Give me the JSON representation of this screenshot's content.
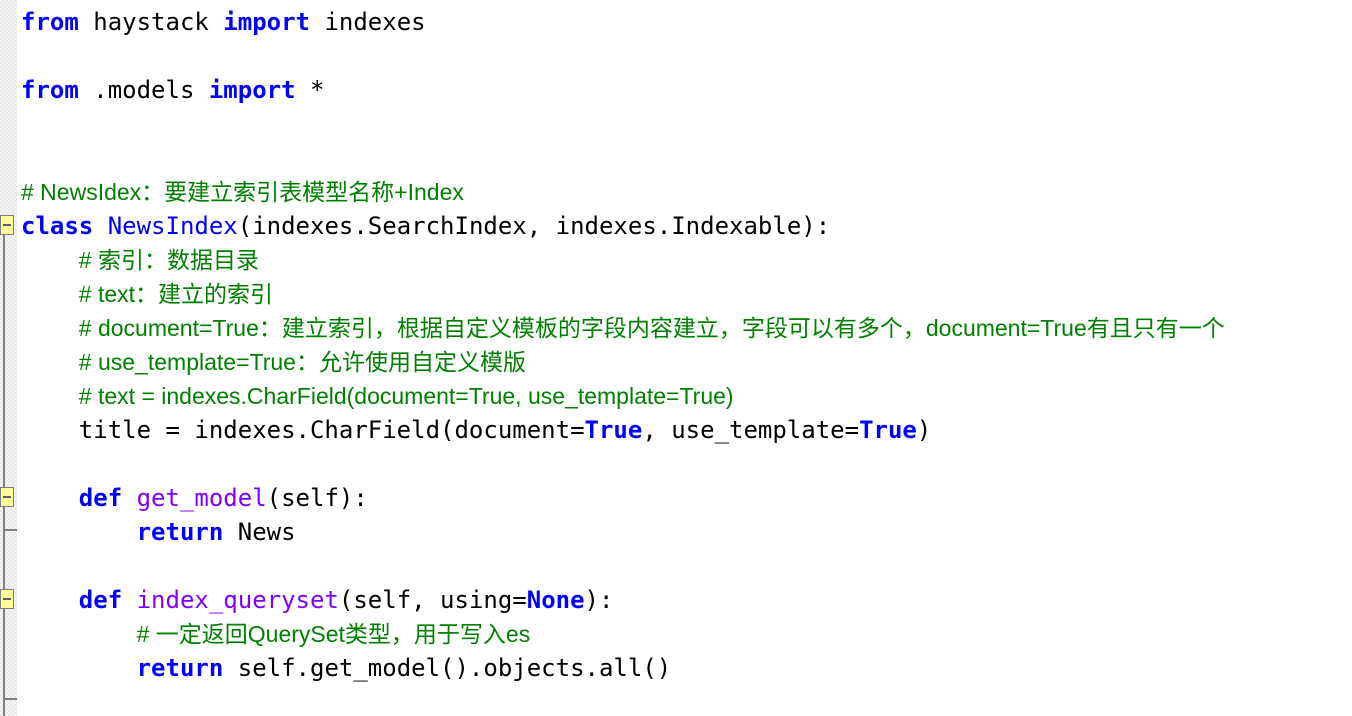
{
  "colors": {
    "keyword": "#0000ff",
    "function": "#8000ff",
    "comment": "#008000",
    "text": "#000000",
    "fold_marker": "#ffff99"
  },
  "editor": {
    "lines": [
      [
        {
          "t": "# ...",
          "c": "cm"
        }
      ],
      [
        {
          "t": "from",
          "c": "kw"
        },
        {
          "t": " haystack ",
          "c": ""
        },
        {
          "t": "import",
          "c": "kw"
        },
        {
          "t": " indexes",
          "c": ""
        }
      ],
      [],
      [
        {
          "t": "from",
          "c": "kw"
        },
        {
          "t": " .models ",
          "c": ""
        },
        {
          "t": "import",
          "c": "kw"
        },
        {
          "t": " *",
          "c": ""
        }
      ],
      [],
      [],
      [
        {
          "t": "# NewsIdex：要建立索引表模型名称+Index",
          "c": "cm"
        }
      ],
      [
        {
          "t": "class",
          "c": "kw"
        },
        {
          "t": " ",
          "c": ""
        },
        {
          "t": "NewsIndex",
          "c": "cls"
        },
        {
          "t": "(indexes.SearchIndex, indexes.Indexable):",
          "c": ""
        }
      ],
      [
        {
          "t": "    ",
          "c": ""
        },
        {
          "t": "# 索引：数据目录",
          "c": "cm"
        }
      ],
      [
        {
          "t": "    ",
          "c": ""
        },
        {
          "t": "# text：建立的索引",
          "c": "cm"
        }
      ],
      [
        {
          "t": "    ",
          "c": ""
        },
        {
          "t": "# document=True：建立索引，根据自定义模板的字段内容建立，字段可以有多个，document=True有且只有一个",
          "c": "cm"
        }
      ],
      [
        {
          "t": "    ",
          "c": ""
        },
        {
          "t": "# use_template=True：允许使用自定义模版",
          "c": "cm"
        }
      ],
      [
        {
          "t": "    ",
          "c": ""
        },
        {
          "t": "# text = indexes.CharField(document=True, use_template=True)",
          "c": "cm"
        }
      ],
      [
        {
          "t": "    title = indexes.CharField(document=",
          "c": ""
        },
        {
          "t": "True",
          "c": "kw"
        },
        {
          "t": ", use_template=",
          "c": ""
        },
        {
          "t": "True",
          "c": "kw"
        },
        {
          "t": ")",
          "c": ""
        }
      ],
      [],
      [
        {
          "t": "    ",
          "c": ""
        },
        {
          "t": "def",
          "c": "kw"
        },
        {
          "t": " ",
          "c": ""
        },
        {
          "t": "get_model",
          "c": "fn"
        },
        {
          "t": "(self):",
          "c": ""
        }
      ],
      [
        {
          "t": "        ",
          "c": ""
        },
        {
          "t": "return",
          "c": "kw"
        },
        {
          "t": " News",
          "c": ""
        }
      ],
      [],
      [
        {
          "t": "    ",
          "c": ""
        },
        {
          "t": "def",
          "c": "kw"
        },
        {
          "t": " ",
          "c": ""
        },
        {
          "t": "index_queryset",
          "c": "fn"
        },
        {
          "t": "(self, using=",
          "c": ""
        },
        {
          "t": "None",
          "c": "kw"
        },
        {
          "t": "):",
          "c": ""
        }
      ],
      [
        {
          "t": "        ",
          "c": ""
        },
        {
          "t": "# 一定返回QuerySet类型，用于写入es",
          "c": "cm"
        }
      ],
      [
        {
          "t": "        ",
          "c": ""
        },
        {
          "t": "return",
          "c": "kw"
        },
        {
          "t": " self.get_model().objects.all()",
          "c": ""
        }
      ]
    ]
  }
}
